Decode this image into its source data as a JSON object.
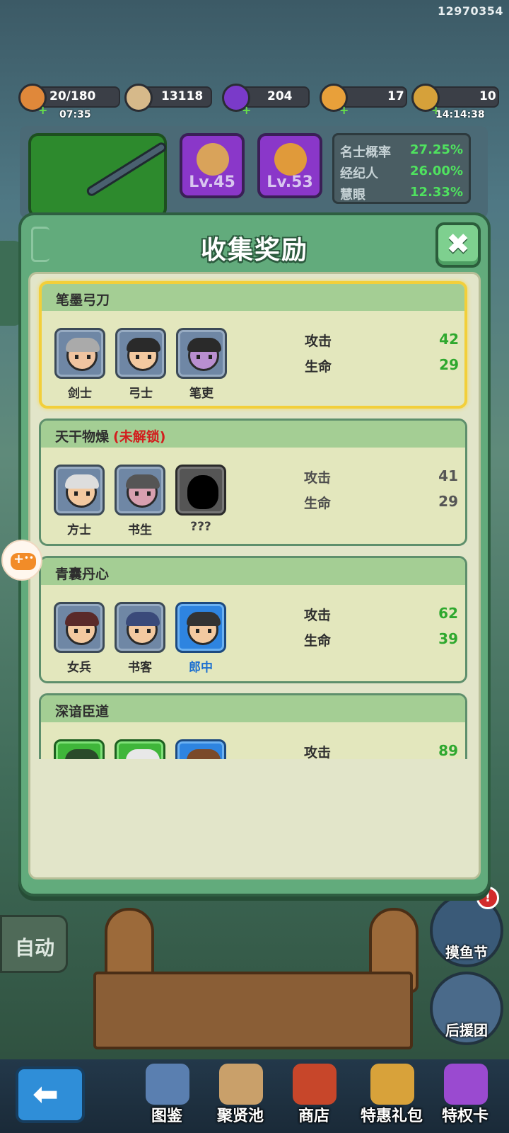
{
  "game_id": "12970354",
  "resources": [
    {
      "name": "stamina",
      "value": "20/180",
      "sub": "07:35",
      "icon": "food-icon",
      "color": "#e0883a"
    },
    {
      "name": "coins",
      "value": "13118",
      "icon": "coin-icon",
      "color": "#d6b98a"
    },
    {
      "name": "gems",
      "value": "204",
      "icon": "purple-gem-icon",
      "color": "#7a3ac9"
    },
    {
      "name": "bait",
      "value": "17",
      "icon": "bait-icon",
      "color": "#e8a03a"
    },
    {
      "name": "rods",
      "value": "10",
      "sub": "14:14:38",
      "icon": "rod-icon",
      "color": "#d6a13a"
    }
  ],
  "equipment": {
    "slot2_level": "Lv.45",
    "slot3_level": "Lv.53"
  },
  "top_stats": [
    {
      "label": "名士概率",
      "value": "27.25%"
    },
    {
      "label": "经纪人",
      "value": "26.00%"
    },
    {
      "label": "慧眼",
      "value": "12.33%"
    }
  ],
  "modal": {
    "title": "收集奖励",
    "close_label": "✖",
    "locked_text": "(未解锁)",
    "cards": [
      {
        "title": "笔墨弓刀",
        "state": "active",
        "heroes": [
          {
            "name": "剑士",
            "rarity": "grey"
          },
          {
            "name": "弓士",
            "rarity": "grey"
          },
          {
            "name": "笔吏",
            "rarity": "grey"
          }
        ],
        "stats": [
          {
            "label": "攻击",
            "value": "42"
          },
          {
            "label": "生命",
            "value": "29"
          }
        ]
      },
      {
        "title": "天干物燥",
        "state": "locked",
        "heroes": [
          {
            "name": "方士",
            "rarity": "grey"
          },
          {
            "name": "书生",
            "rarity": "grey"
          },
          {
            "name": "???",
            "rarity": "unknown"
          }
        ],
        "stats": [
          {
            "label": "攻击",
            "value": "41"
          },
          {
            "label": "生命",
            "value": "29"
          }
        ]
      },
      {
        "title": "青囊丹心",
        "state": "normal",
        "heroes": [
          {
            "name": "女兵",
            "rarity": "grey"
          },
          {
            "name": "书客",
            "rarity": "grey"
          },
          {
            "name": "郎中",
            "rarity": "blue"
          }
        ],
        "stats": [
          {
            "label": "攻击",
            "value": "62"
          },
          {
            "label": "生命",
            "value": "39"
          }
        ]
      },
      {
        "title": "深谙臣道",
        "state": "normal",
        "heroes": [
          {
            "name": "",
            "rarity": "green"
          },
          {
            "name": "",
            "rarity": "green"
          },
          {
            "name": "",
            "rarity": "blue"
          }
        ],
        "stats": [
          {
            "label": "攻击",
            "value": "89"
          }
        ]
      }
    ]
  },
  "auto_label": "自动",
  "side_buttons": [
    {
      "label": "摸鱼节",
      "badge": "!"
    },
    {
      "label": "后援团"
    }
  ],
  "nav": [
    {
      "label": "图鉴"
    },
    {
      "label": "聚贤池"
    },
    {
      "label": "商店"
    },
    {
      "label": "特惠礼包"
    },
    {
      "label": "特权卡"
    }
  ],
  "colors": {
    "value_green": "#2ea82e",
    "locked_red": "#d21e1e",
    "modal_green": "#62ab7c",
    "active_border": "#f2cf3a"
  }
}
